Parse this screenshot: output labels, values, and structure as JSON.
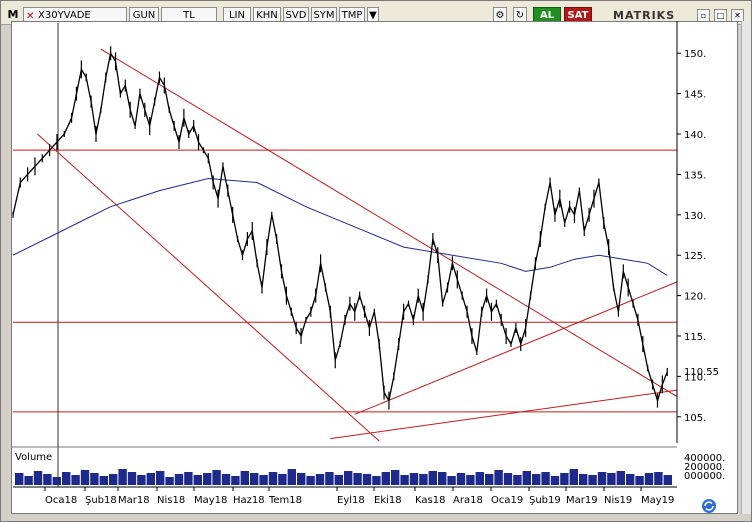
{
  "toolbar": {
    "menu_label": "M",
    "symbol": "X30YVADE",
    "period": "GUN",
    "currency": "TL",
    "scale": "LIN",
    "buttons": [
      "KHN",
      "SVD",
      "SYM",
      "TMP"
    ],
    "buy_label": "AL",
    "sell_label": "SAT",
    "brand": "MATRIKS",
    "win_min": "▫",
    "win_max": "□",
    "win_close": "✕"
  },
  "chart_data": {
    "type": "line",
    "title": "",
    "y_ticks": [
      105,
      110,
      115,
      120,
      125,
      130,
      135,
      140,
      145,
      150
    ],
    "ylim": [
      102,
      153
    ],
    "current_value_label": "110.55",
    "current_value": 110.55,
    "x_ticks": [
      "Oca18",
      "Şub18",
      "Mar18",
      "Nis18",
      "May18",
      "Haz18",
      "Tem18",
      "Eyl18",
      "Eki18",
      "Kas18",
      "Ara18",
      "Oca19",
      "Şub19",
      "Mar19",
      "Nis19",
      "May19"
    ],
    "series": [
      {
        "name": "",
        "values": [
          [
            0,
            130
          ],
          [
            3,
            134
          ],
          [
            6,
            135
          ],
          [
            9,
            136
          ],
          [
            12,
            137
          ],
          [
            15,
            138
          ],
          [
            18,
            139
          ],
          [
            21,
            140
          ],
          [
            24,
            142
          ],
          [
            26,
            145
          ],
          [
            28,
            148
          ],
          [
            30,
            147
          ],
          [
            32,
            144
          ],
          [
            34,
            140
          ],
          [
            36,
            143
          ],
          [
            38,
            147
          ],
          [
            40,
            150
          ],
          [
            42,
            149
          ],
          [
            44,
            145
          ],
          [
            46,
            146
          ],
          [
            48,
            143
          ],
          [
            50,
            141
          ],
          [
            52,
            145
          ],
          [
            54,
            143
          ],
          [
            56,
            141
          ],
          [
            58,
            144
          ],
          [
            60,
            147
          ],
          [
            62,
            146
          ],
          [
            64,
            143
          ],
          [
            66,
            141
          ],
          [
            68,
            139
          ],
          [
            70,
            142
          ],
          [
            72,
            140
          ],
          [
            74,
            141
          ],
          [
            76,
            139
          ],
          [
            78,
            138
          ],
          [
            80,
            137
          ],
          [
            82,
            134
          ],
          [
            84,
            132
          ],
          [
            86,
            136
          ],
          [
            88,
            133
          ],
          [
            90,
            130
          ],
          [
            92,
            127
          ],
          [
            94,
            125
          ],
          [
            96,
            127
          ],
          [
            98,
            128
          ],
          [
            100,
            124
          ],
          [
            102,
            121
          ],
          [
            104,
            126
          ],
          [
            106,
            130
          ],
          [
            108,
            127
          ],
          [
            110,
            123
          ],
          [
            112,
            120
          ],
          [
            114,
            118
          ],
          [
            116,
            116
          ],
          [
            118,
            115
          ],
          [
            120,
            117
          ],
          [
            122,
            118
          ],
          [
            124,
            120
          ],
          [
            126,
            124
          ],
          [
            128,
            121
          ],
          [
            130,
            118
          ],
          [
            132,
            112
          ],
          [
            134,
            114
          ],
          [
            136,
            117
          ],
          [
            138,
            119
          ],
          [
            140,
            118
          ],
          [
            142,
            120
          ],
          [
            144,
            118
          ],
          [
            146,
            116
          ],
          [
            148,
            118
          ],
          [
            150,
            114
          ],
          [
            152,
            108
          ],
          [
            154,
            107
          ],
          [
            156,
            110
          ],
          [
            158,
            114
          ],
          [
            160,
            118
          ],
          [
            162,
            119
          ],
          [
            164,
            117
          ],
          [
            166,
            120
          ],
          [
            168,
            118
          ],
          [
            170,
            122
          ],
          [
            172,
            127
          ],
          [
            174,
            125
          ],
          [
            176,
            119
          ],
          [
            178,
            121
          ],
          [
            180,
            124
          ],
          [
            182,
            122
          ],
          [
            184,
            120
          ],
          [
            186,
            118
          ],
          [
            188,
            115
          ],
          [
            190,
            113
          ],
          [
            192,
            118
          ],
          [
            194,
            120
          ],
          [
            196,
            118
          ],
          [
            198,
            119
          ],
          [
            200,
            117
          ],
          [
            202,
            115
          ],
          [
            204,
            114
          ],
          [
            206,
            116
          ],
          [
            208,
            114
          ],
          [
            210,
            116
          ],
          [
            212,
            120
          ],
          [
            214,
            124
          ],
          [
            216,
            127
          ],
          [
            218,
            131
          ],
          [
            220,
            134
          ],
          [
            222,
            130
          ],
          [
            224,
            132
          ],
          [
            226,
            129
          ],
          [
            228,
            131
          ],
          [
            230,
            130
          ],
          [
            232,
            133
          ],
          [
            234,
            128
          ],
          [
            236,
            130
          ],
          [
            238,
            132
          ],
          [
            240,
            134
          ],
          [
            242,
            129
          ],
          [
            244,
            126
          ],
          [
            246,
            121
          ],
          [
            248,
            118
          ],
          [
            250,
            123
          ],
          [
            252,
            121
          ],
          [
            254,
            119
          ],
          [
            256,
            117
          ],
          [
            258,
            114
          ],
          [
            260,
            111
          ],
          [
            262,
            109
          ],
          [
            264,
            107
          ],
          [
            266,
            109
          ],
          [
            268,
            110.55
          ]
        ]
      },
      {
        "name": "",
        "values": [
          [
            0,
            125
          ],
          [
            20,
            128
          ],
          [
            40,
            131
          ],
          [
            60,
            133
          ],
          [
            80,
            134.5
          ],
          [
            100,
            134
          ],
          [
            120,
            131
          ],
          [
            140,
            128.5
          ],
          [
            160,
            126
          ],
          [
            180,
            125
          ],
          [
            200,
            124
          ],
          [
            210,
            123
          ],
          [
            220,
            123.5
          ],
          [
            230,
            124.5
          ],
          [
            240,
            125
          ],
          [
            250,
            124.5
          ],
          [
            260,
            124
          ],
          [
            268,
            122.5
          ]
        ]
      }
    ],
    "volume_label": "Volume",
    "volume_axis_labels": [
      "400000.",
      "200000.",
      "000000."
    ],
    "volume": [
      1.2,
      0.9,
      1.4,
      1.1,
      0.8,
      1.3,
      1.0,
      1.5,
      1.2,
      0.9,
      1.1,
      1.6,
      1.3,
      1.0,
      1.2,
      1.4,
      0.8,
      1.1,
      1.3,
      1.0,
      1.2,
      1.5,
      1.1,
      0.9,
      1.4,
      1.2,
      1.0,
      1.3,
      1.1,
      1.6,
      1.2,
      0.9,
      1.1,
      1.3,
      1.0,
      1.4,
      1.2,
      1.1,
      0.9,
      1.3,
      1.5,
      1.0,
      1.2,
      1.1,
      1.4,
      1.3,
      0.9,
      1.2,
      1.0,
      1.3,
      1.1,
      1.5,
      1.2,
      1.0,
      1.4,
      1.1,
      1.3,
      0.9,
      1.2,
      1.6,
      1.1,
      1.0,
      1.3,
      1.2,
      1.4,
      1.1,
      0.9,
      1.2,
      1.3,
      1.0
    ]
  }
}
